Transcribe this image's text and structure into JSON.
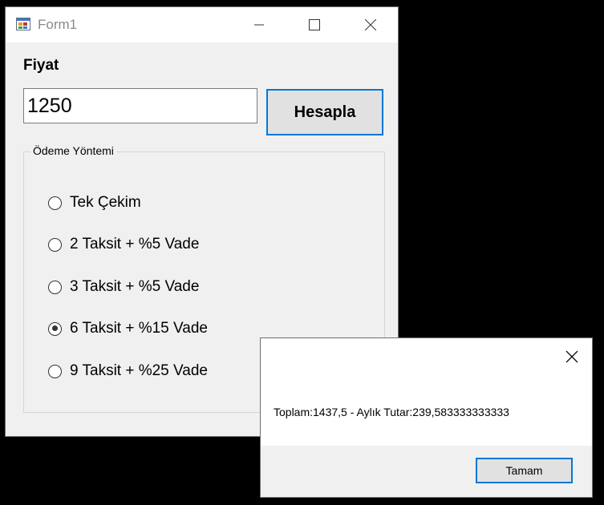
{
  "window": {
    "title": "Form1",
    "icon": "winforms-app-icon",
    "controls": {
      "minimize_icon": "minimize-icon",
      "maximize_icon": "maximize-icon",
      "close_icon": "close-icon"
    }
  },
  "form": {
    "price_label": "Fiyat",
    "price_value": "1250",
    "calculate_label": "Hesapla",
    "group_title": "Ödeme Yöntemi",
    "options": [
      {
        "label": "Tek Çekim",
        "checked": false
      },
      {
        "label": "2 Taksit + %5 Vade",
        "checked": false
      },
      {
        "label": "3 Taksit + %5 Vade",
        "checked": false
      },
      {
        "label": "6 Taksit + %15 Vade",
        "checked": true
      },
      {
        "label": "9 Taksit + %25 Vade",
        "checked": false
      }
    ]
  },
  "message_box": {
    "text": "Toplam:1437,5 - Aylık Tutar:239,583333333333",
    "ok_label": "Tamam",
    "close_icon": "close-icon"
  },
  "colors": {
    "accent": "#0078d7",
    "form_background": "#f0f0f0",
    "button_background": "#e1e1e1"
  }
}
